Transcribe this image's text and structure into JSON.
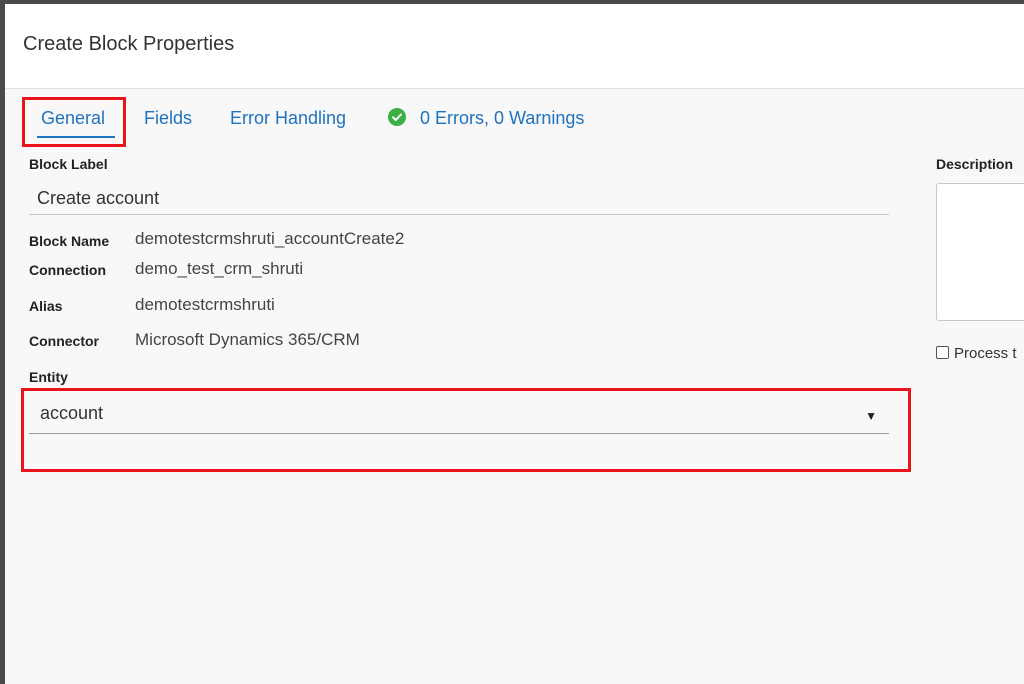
{
  "dialog": {
    "title": "Create Block Properties"
  },
  "tabs": [
    {
      "label": "General",
      "active": true
    },
    {
      "label": "Fields",
      "active": false
    },
    {
      "label": "Error Handling",
      "active": false
    }
  ],
  "status": {
    "icon": "check-circle-icon",
    "text": "0 Errors, 0 Warnings",
    "color": "#3cb043"
  },
  "form": {
    "block_label": {
      "label": "Block Label",
      "value": "Create account"
    },
    "block_name": {
      "label": "Block Name",
      "value": "demotestcrmshruti_accountCreate2"
    },
    "connection": {
      "label": "Connection",
      "value": "demo_test_crm_shruti"
    },
    "alias": {
      "label": "Alias",
      "value": "demotestcrmshruti"
    },
    "connector": {
      "label": "Connector",
      "value": "Microsoft Dynamics 365/CRM"
    },
    "entity": {
      "label": "Entity",
      "value": "account"
    }
  },
  "description": {
    "label": "Description"
  },
  "process": {
    "label": "Process t",
    "checked": false
  },
  "colors": {
    "accent": "#1e73be",
    "highlight": "#e8141c"
  }
}
